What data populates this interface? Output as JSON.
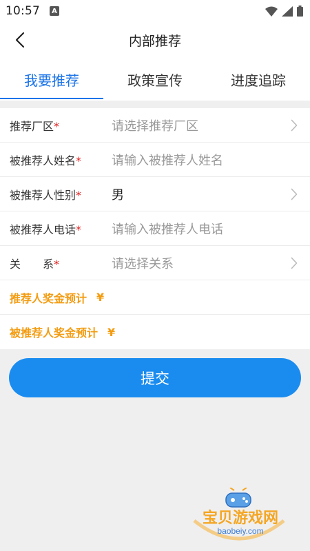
{
  "status_bar": {
    "time": "10:57",
    "notification_letter": "A"
  },
  "header": {
    "title": "内部推荐"
  },
  "tabs": [
    {
      "label": "我要推荐",
      "active": true
    },
    {
      "label": "政策宣传",
      "active": false
    },
    {
      "label": "进度追踪",
      "active": false
    }
  ],
  "form": {
    "factory": {
      "label": "推荐厂区",
      "required_mark": "*",
      "placeholder": "请选择推荐厂区"
    },
    "name": {
      "label": "被推荐人姓名",
      "required_mark": "*",
      "placeholder": "请输入被推荐人姓名"
    },
    "gender": {
      "label": "被推荐人性别",
      "required_mark": "*",
      "value": "男"
    },
    "phone": {
      "label": "被推荐人电话",
      "required_mark": "*",
      "placeholder": "请输入被推荐人电话"
    },
    "relation": {
      "label": "关　　系",
      "required_mark": "*",
      "placeholder": "请选择关系"
    },
    "referrer_bonus": {
      "label": "推荐人奖金预计",
      "value": "¥"
    },
    "referee_bonus": {
      "label": "被推荐人奖金预计",
      "value": "¥"
    }
  },
  "submit": {
    "label": "提交"
  },
  "watermark": {
    "text": "宝贝游戏网",
    "url": "baobeiy.com"
  },
  "colors": {
    "accent": "#1a73e8",
    "button": "#1a8cf0",
    "bonus": "#f39c12",
    "required": "#e02020"
  }
}
